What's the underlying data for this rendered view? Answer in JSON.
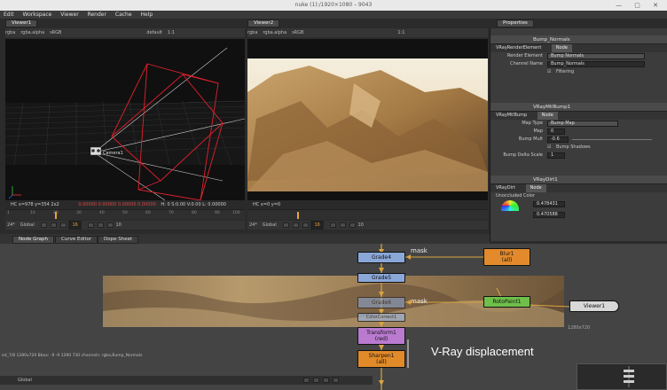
{
  "window": {
    "title": "nuke (1):/1920×1080 – 9043"
  },
  "menu": [
    "Edit",
    "Workspace",
    "Viewer",
    "Render",
    "Cache",
    "Help"
  ],
  "viewer1": {
    "tab": "Viewer1",
    "channels": "rgba",
    "layer": "rgba.alpha",
    "colorspace": "sRGB",
    "zoom": "1:1",
    "view": "default",
    "camera_label": "Camera1",
    "info_hc": "HC",
    "info_xy": "x=978 y=354 2x2",
    "info_vals": "0.00000   0.00000   0.00000   0.00000",
    "info_hsvl": "H: 0 S:0.00 V:0.00  L: 0.00000",
    "frame": "24*",
    "mode": "Global",
    "current_frame": "16",
    "step": "10"
  },
  "viewer2": {
    "tab": "Viewer2",
    "channels": "rgba",
    "layer": "rgba.alpha",
    "colorspace": "sRGB",
    "zoom": "1:1",
    "info_hc": "HC",
    "info_xy": "x=0 y=0",
    "frame": "24*",
    "mode": "Global",
    "current_frame": "16",
    "step": "10"
  },
  "timeline_ticks": [
    "1",
    "10",
    "20",
    "30",
    "40",
    "50",
    "60",
    "70",
    "80",
    "90",
    "100"
  ],
  "properties": {
    "tab": "Properties",
    "panels": [
      {
        "name": "Bump_Normals",
        "class": "VRayRenderElement",
        "subtab": "Node",
        "rows": [
          {
            "label": "Render Element",
            "value": "Bump Normals",
            "kind": "dropdown"
          },
          {
            "label": "Channel Name",
            "value": "Bump_Normals",
            "kind": "field"
          },
          {
            "label": "",
            "value": "Filtering",
            "kind": "check"
          }
        ]
      },
      {
        "name": "VRayMtlBump1",
        "class": "VRayMtlBump",
        "subtab": "Node",
        "rows": [
          {
            "label": "Map Type",
            "value": "Bump Map",
            "kind": "dropdown"
          },
          {
            "label": "Map",
            "value": "0",
            "kind": "field"
          },
          {
            "label": "Bump Mult",
            "value": "-0.6",
            "kind": "field"
          },
          {
            "label": "",
            "value": "Bump Shadows",
            "kind": "check"
          },
          {
            "label": "Bump Delta Scale",
            "value": "1",
            "kind": "field"
          }
        ]
      },
      {
        "name": "VRayDirt1",
        "class": "VRayDirt",
        "subtab": "Node",
        "rows": [
          {
            "label": "Unoccluded Color",
            "value": "",
            "kind": "label"
          },
          {
            "label": "",
            "value": "0.478431",
            "kind": "field"
          },
          {
            "label": "",
            "value": "0.470588",
            "kind": "field"
          }
        ]
      }
    ]
  },
  "graph_tabs": [
    "Node Graph",
    "Curve Editor",
    "Dope Sheet"
  ],
  "nodes": {
    "grade4": "Grade4",
    "grade5": "Grade5",
    "roto_hidden": "Grade6",
    "color_correct": "ColorCorrect1",
    "transform": "Transform1",
    "transform_sub": "(red)",
    "sharpen": "Sharpen1",
    "sharpen_sub": "(all)",
    "blur": "Blur1",
    "blur_sub": "(all)",
    "rotopaint": "RotoPaint1",
    "viewer": "Viewer1"
  },
  "edge_labels": {
    "mask1": "mask",
    "mask2": "mask"
  },
  "overlay_title": "V-Ray displacement",
  "read_label": "1280x720",
  "status_line": "ed_7/8 1280x720  Bbox: -9 -9 1290 730 channels: rgba,Bump_Normals",
  "colors": {
    "grade": "#8aa7d8",
    "blur": "#e28a2c",
    "roto": "#6fbf4b",
    "transform": "#b97ad0",
    "sharpen": "#e08a2a",
    "viewer": "#d8d8d8",
    "camera_frustum": "#e3202c"
  }
}
